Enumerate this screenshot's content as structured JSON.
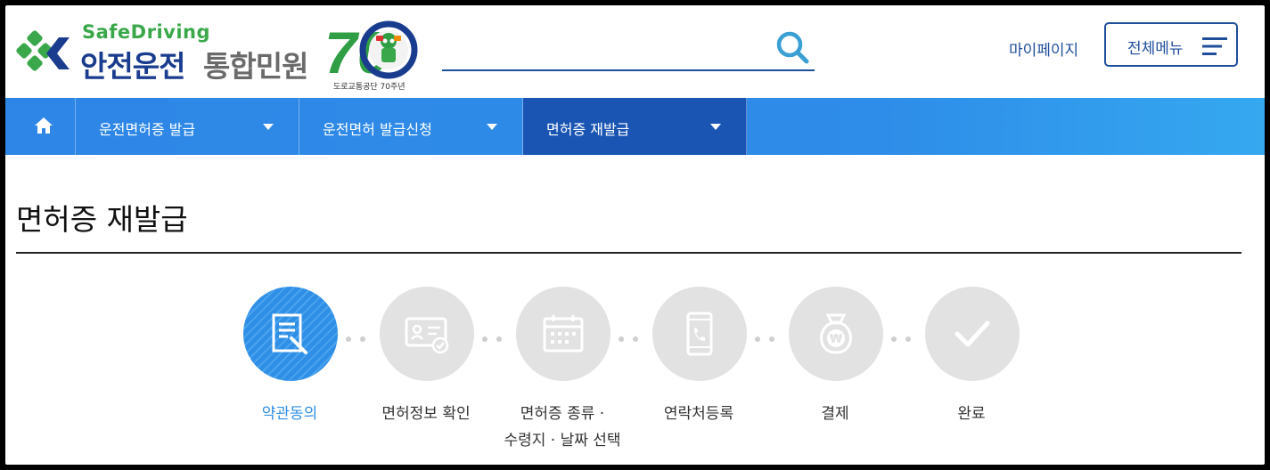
{
  "header": {
    "logo_en": "SafeDriving",
    "logo_main": "안전운전",
    "logo_sub": "통합민원",
    "anniversary_caption": "도로교통공단 70주년",
    "anniversary_number": "70",
    "search_icon": "search-icon",
    "mypage_label": "마이페이지",
    "allmenu_label": "전체메뉴",
    "allmenu_icon": "hamburger-icon",
    "search_placeholder": ""
  },
  "nav": {
    "home_icon": "home-icon",
    "items": [
      {
        "label": "운전면허증 발급",
        "active": false
      },
      {
        "label": "운전면허 발급신청",
        "active": false
      },
      {
        "label": "면허증 재발급",
        "active": true
      }
    ]
  },
  "page": {
    "title": "면허증 재발급"
  },
  "steps": [
    {
      "label": "약관동의",
      "icon": "document-edit-icon",
      "active": true
    },
    {
      "label": "면허정보 확인",
      "icon": "id-card-check-icon",
      "active": false
    },
    {
      "label_line1": "면허증 종류 ·",
      "label_line2": "수령지 · 날짜 선택",
      "icon": "calendar-icon",
      "active": false
    },
    {
      "label": "연락처등록",
      "icon": "mobile-phone-icon",
      "active": false
    },
    {
      "label": "결제",
      "icon": "won-bag-icon",
      "active": false
    },
    {
      "label": "완료",
      "icon": "checkmark-icon",
      "active": false
    }
  ],
  "colors": {
    "brand_navy": "#1a3c8e",
    "brand_green": "#3aa84a",
    "nav_blue": "#2e86e6",
    "nav_active": "#1b55b3",
    "step_active": "#2f8fe6",
    "step_inactive": "#e2e2e2"
  }
}
